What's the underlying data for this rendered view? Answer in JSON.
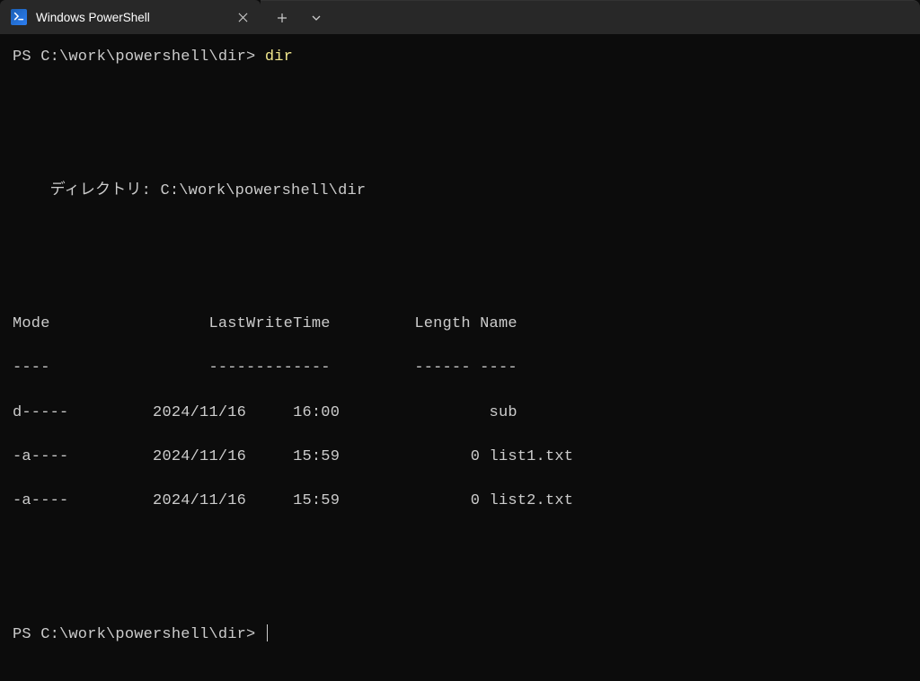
{
  "titlebar": {
    "tab_title": "Windows PowerShell"
  },
  "terminal": {
    "prompt1": "PS C:\\work\\powershell\\dir> ",
    "command1": "dir",
    "directory_label": "ディレクトリ",
    "directory_separator": ": ",
    "directory_path": "C:\\work\\powershell\\dir",
    "headers": {
      "mode": "Mode",
      "lastwrite": "LastWriteTime",
      "length": "Length",
      "name": "Name"
    },
    "header_underlines": {
      "mode": "----",
      "lastwrite": "-------------",
      "length": "------",
      "name": "----"
    },
    "rows": [
      {
        "mode": "d-----",
        "date": "2024/11/16",
        "time": "16:00",
        "length": "",
        "name": "sub"
      },
      {
        "mode": "-a----",
        "date": "2024/11/16",
        "time": "15:59",
        "length": "0",
        "name": "list1.txt"
      },
      {
        "mode": "-a----",
        "date": "2024/11/16",
        "time": "15:59",
        "length": "0",
        "name": "list2.txt"
      }
    ],
    "prompt2": "PS C:\\work\\powershell\\dir> "
  }
}
